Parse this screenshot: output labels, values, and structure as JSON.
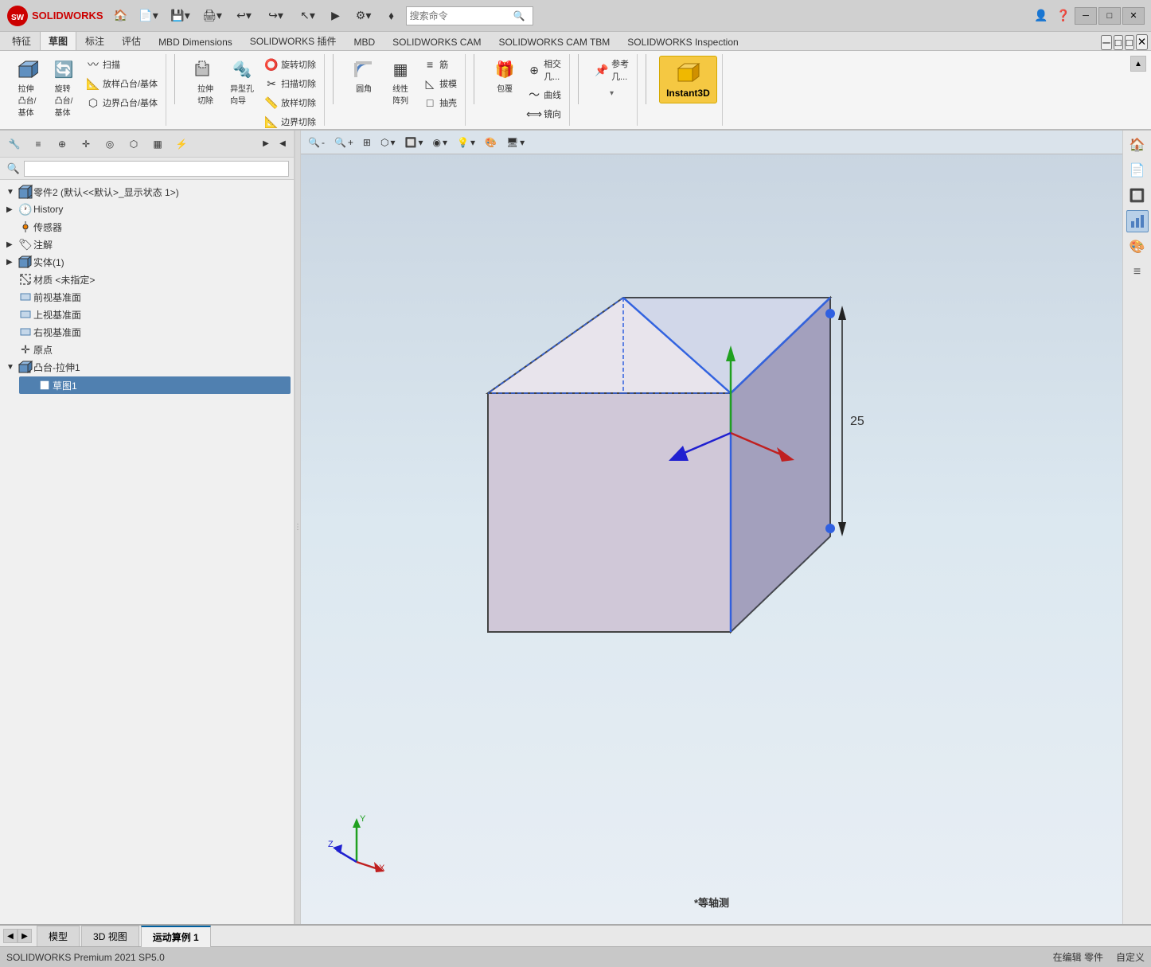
{
  "app": {
    "title": "SOLIDWORKS Premium 2021 SP5.0",
    "logo_text": "SOLIDWORKS",
    "window_title": "零件2 (默认<<默认>_显示状态 1) - SOLIDWORKS Premium 2021 SP5.0"
  },
  "titlebar": {
    "minimize": "─",
    "restore": "□",
    "close": "✕"
  },
  "top_toolbar": {
    "buttons": [
      "🏠",
      "📄",
      "💾",
      "🖨",
      "↩",
      "↪",
      "↖",
      "⚙",
      "🔍",
      "👤",
      "❓"
    ]
  },
  "search": {
    "placeholder": "搜索命令",
    "icon": "🔍"
  },
  "ribbon_tabs": {
    "items": [
      {
        "label": "特征",
        "active": false
      },
      {
        "label": "草图",
        "active": true
      },
      {
        "label": "标注",
        "active": false
      },
      {
        "label": "评估",
        "active": false
      },
      {
        "label": "MBD Dimensions",
        "active": false
      },
      {
        "label": "SOLIDWORKS 插件",
        "active": false
      },
      {
        "label": "MBD",
        "active": false
      },
      {
        "label": "SOLIDWORKS CAM",
        "active": false
      },
      {
        "label": "SOLIDWORKS CAM TBM",
        "active": false
      },
      {
        "label": "SOLIDWORKS Inspection",
        "active": false
      }
    ]
  },
  "ribbon": {
    "groups": [
      {
        "name": "拉伸",
        "buttons": [
          {
            "label": "拉伸\n凸台/\n基体",
            "icon": "⬛"
          },
          {
            "label": "旋转\n凸台/\n基体",
            "icon": "🔄"
          },
          {
            "label": "扫描",
            "icon": "〰"
          },
          {
            "label": "放样凸台/基体",
            "icon": "📐"
          }
        ]
      },
      {
        "name": "拉伸切除",
        "buttons": [
          {
            "label": "拉伸\n切除",
            "icon": "⬜"
          },
          {
            "label": "异型孔\n向导",
            "icon": "🔩"
          },
          {
            "label": "旋转\n切除",
            "icon": "⭕"
          }
        ]
      },
      {
        "name": "特征",
        "buttons": [
          {
            "label": "扫描切除",
            "icon": "✂"
          },
          {
            "label": "放样切除",
            "icon": "📏"
          },
          {
            "label": "边界切除",
            "icon": "📐"
          }
        ]
      },
      {
        "name": "阵列",
        "buttons": [
          {
            "label": "圆角",
            "icon": "⌒"
          },
          {
            "label": "线性\n阵列",
            "icon": "▦"
          },
          {
            "label": "筋",
            "icon": "≡"
          },
          {
            "label": "拔模",
            "icon": "◺"
          },
          {
            "label": "抽壳",
            "icon": "□"
          }
        ]
      },
      {
        "name": "包覆",
        "buttons": [
          {
            "label": "包覆",
            "icon": "🎁"
          },
          {
            "label": "相交\n几...",
            "icon": "⊕"
          },
          {
            "label": "曲线",
            "icon": "〜"
          },
          {
            "label": "镜向",
            "icon": "⟺"
          }
        ]
      },
      {
        "name": "参考",
        "buttons": [
          {
            "label": "参考\n几...",
            "icon": "📌"
          }
        ]
      },
      {
        "name": "Instant3D",
        "label": "Instant3D",
        "special": true
      }
    ]
  },
  "feature_tree": {
    "root_label": "零件2 (默认<<默认>_显示状态 1>)",
    "items": [
      {
        "id": "history",
        "label": "History",
        "icon": "🕐",
        "level": 1,
        "expanded": false,
        "selected": false
      },
      {
        "id": "sensor",
        "label": "传感器",
        "icon": "📡",
        "level": 1,
        "expanded": false
      },
      {
        "id": "annotation",
        "label": "注解",
        "icon": "🏷",
        "level": 1,
        "expanded": false
      },
      {
        "id": "solid",
        "label": "实体(1)",
        "icon": "⬛",
        "level": 1,
        "expanded": false
      },
      {
        "id": "material",
        "label": "材质 <未指定>",
        "icon": "🔲",
        "level": 1
      },
      {
        "id": "front",
        "label": "前视基准面",
        "icon": "▭",
        "level": 1
      },
      {
        "id": "top",
        "label": "上视基准面",
        "icon": "▭",
        "level": 1
      },
      {
        "id": "right",
        "label": "右视基准面",
        "icon": "▭",
        "level": 1
      },
      {
        "id": "origin",
        "label": "原点",
        "icon": "✛",
        "level": 1
      },
      {
        "id": "extrude1",
        "label": "凸台-拉伸1",
        "icon": "⬛",
        "level": 1,
        "expanded": true
      },
      {
        "id": "sketch1",
        "label": "草图1",
        "icon": "📋",
        "level": 2,
        "selected": true
      }
    ]
  },
  "left_toolbar_icons": [
    "🔍",
    "≡",
    "⊕",
    "✛",
    "◎",
    "⬡",
    "▦",
    "⚡",
    "▶",
    "◀"
  ],
  "view_toolbar": {
    "buttons": [
      {
        "label": "🔍-",
        "tip": "缩小"
      },
      {
        "label": "🔍+",
        "tip": "放大"
      },
      {
        "label": "🔧",
        "tip": "工具"
      },
      {
        "label": "⬡",
        "tip": "视图"
      },
      {
        "label": "🔲",
        "tip": "显示样式"
      },
      {
        "label": "◉",
        "tip": "视图方向"
      },
      {
        "label": "💡",
        "tip": "光源"
      },
      {
        "label": "🎨",
        "tip": "外观"
      },
      {
        "label": "🖥",
        "tip": "场景"
      }
    ]
  },
  "right_panel_icons": [
    "🏠",
    "📄",
    "🔲",
    "📊",
    "🎨",
    "≡"
  ],
  "view_label": "*等轴测",
  "bottom_tabs": [
    {
      "label": "模型",
      "active": false
    },
    {
      "label": "3D 视图",
      "active": false
    },
    {
      "label": "运动算例 1",
      "active": false
    }
  ],
  "status_bar": {
    "left": "SOLIDWORKS Premium 2021 SP5.0",
    "middle": "在编辑 零件",
    "right": "自定义"
  },
  "colors": {
    "accent_blue": "#0060a0",
    "highlight_yellow": "#f5c842",
    "bg_light": "#f0f0f0",
    "bg_medium": "#e0e0e0",
    "toolbar_bg": "#dcdcdc",
    "view_bg_top": "#c8d4e0",
    "view_bg_bottom": "#e8eef4",
    "box_selected": "#b0d0e8",
    "shape_fill": "#c8b8c8",
    "shape_stroke": "#222",
    "axis_blue": "#3060e0",
    "axis_yellow": "#d0b000"
  }
}
